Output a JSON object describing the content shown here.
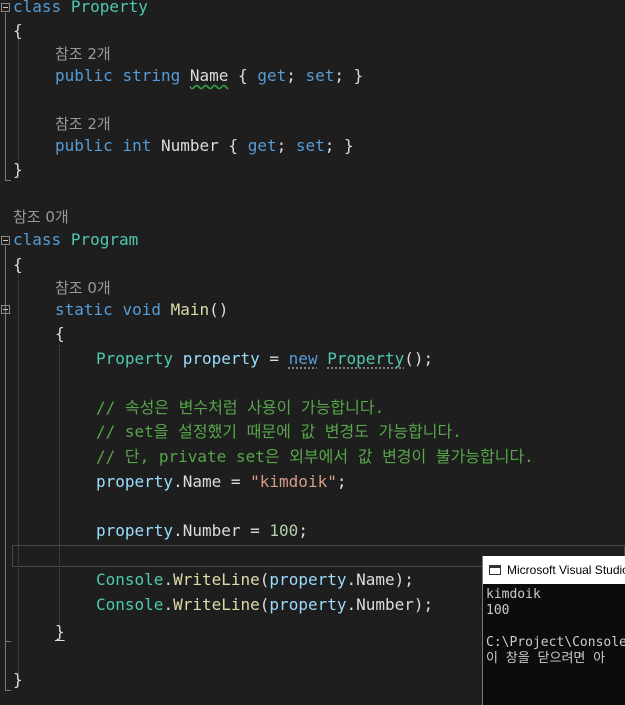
{
  "code": {
    "lens_property_name": "참조 2개",
    "lens_property_number": "참조 2개",
    "lens_class_program": "참조 0개",
    "lens_main": "참조 0개",
    "kw_class": "class",
    "class_property": "Property",
    "class_program": "Program",
    "kw_public": "public",
    "kw_string": "string",
    "kw_int": "int",
    "kw_static": "static",
    "kw_void": "void",
    "kw_new": "new",
    "kw_get": "get",
    "kw_set": "set",
    "prop_name": "Name",
    "prop_number": "Number",
    "method_main": "Main",
    "var_property": "property",
    "comment_1": "// 속성은 변수처럼 사용이 가능합니다.",
    "comment_2": "// set을 설정했기 때문에 값 변경도 가능합니다.",
    "comment_3": "// 단, private set은 외부에서 값 변경이 불가능합니다.",
    "string_value": "\"kimdoik\"",
    "number_value": "100",
    "console_class": "Console",
    "method_writeline": "WriteLine"
  },
  "console": {
    "title": "Microsoft Visual Studio",
    "lines": [
      "kimdoik",
      "100",
      "",
      "C:\\Project\\Console",
      "이 창을 닫으려면 아"
    ]
  }
}
